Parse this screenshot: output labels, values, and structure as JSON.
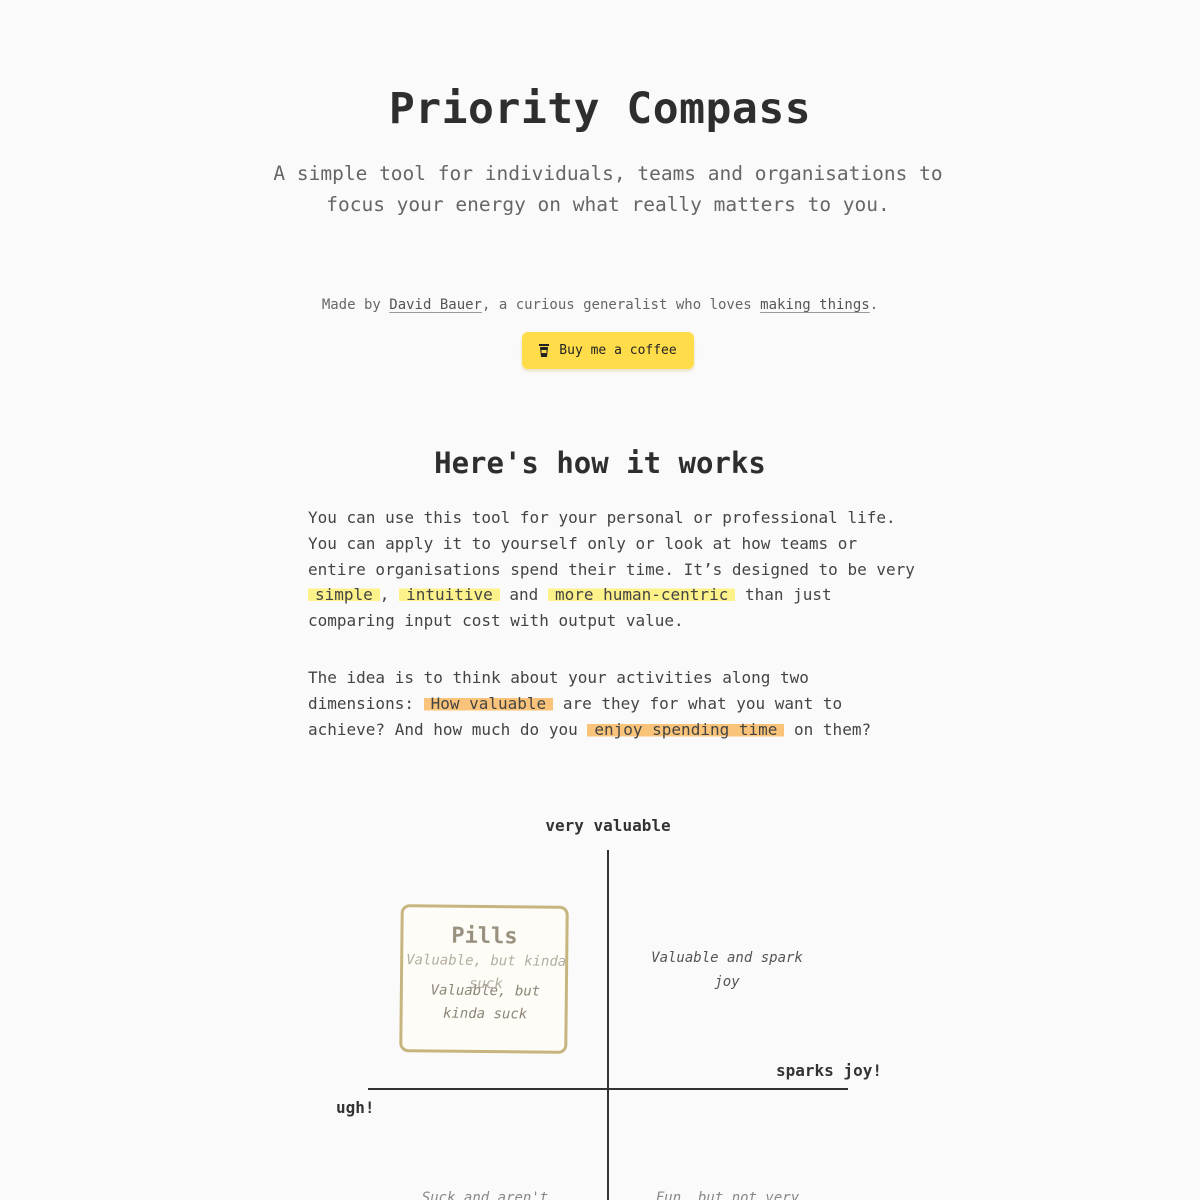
{
  "header": {
    "title": "Priority Compass",
    "subtitle": "A simple tool for individuals, teams and organisations to focus your energy on what really matters to you."
  },
  "credits": {
    "prefix": "Made by ",
    "author_link": "David Bauer",
    "middle": ", a curious generalist who loves ",
    "things_link": "making things",
    "suffix": ".",
    "coffee_button": "Buy me a coffee",
    "coffee_icon": "coffee-cup-icon",
    "button_color": "#ffdd4a"
  },
  "how_it_works": {
    "title": "Here's how it works",
    "p1_a": "You can use this tool for your personal or professional life. You can apply it to yourself only or look at how teams or entire organisations spend their time. It’s designed to be very ",
    "p1_h1": "simple",
    "p1_b": ", ",
    "p1_h2": "intuitive",
    "p1_c": " and ",
    "p1_h3": "more human-centric",
    "p1_d": " than just comparing input cost with output value.",
    "p2_a": "The idea is to think about your activities along two dimensions: ",
    "p2_h1": "How valuable",
    "p2_b": " are they for what you want to achieve? And how much do you ",
    "p2_h2": "enjoy spending time",
    "p2_c": " on them?",
    "highlight_colors": {
      "yellow": "#fdf28a",
      "orange": "#f9c479"
    }
  },
  "compass": {
    "axis_top": "very valuable",
    "axis_right": "sparks joy!",
    "axis_left": "ugh!",
    "quadrant_top_right": "Valuable and spark joy",
    "quadrant_bottom_left": "Suck and aren't",
    "quadrant_bottom_right": "Fun, but not very",
    "card": {
      "title": "Pills",
      "subtitle": "Valuable, but kinda suck",
      "note": "Valuable, but kinda suck"
    }
  }
}
